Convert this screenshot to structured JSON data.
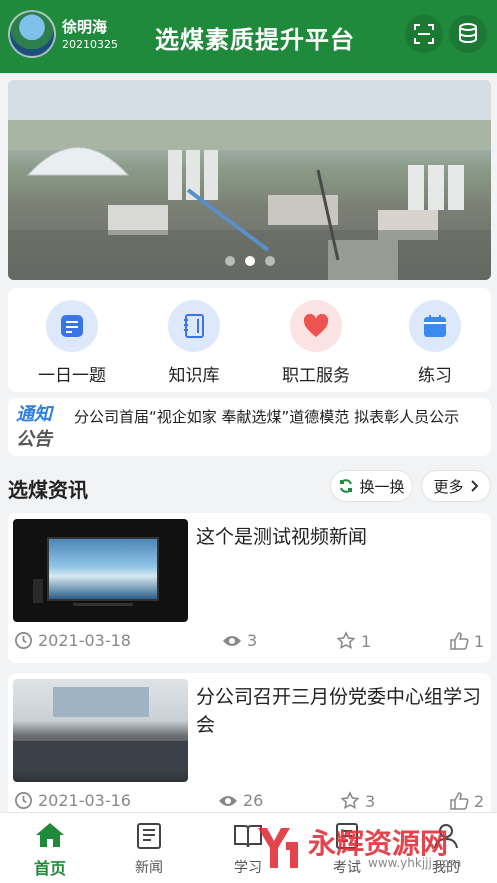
{
  "header": {
    "user_name": "徐明海",
    "user_id": "20210325",
    "title": "选煤素质提升平台",
    "scan_icon": "scan-icon",
    "data_icon": "database-icon",
    "accent": "#1f8a3b"
  },
  "banner": {
    "dot_count": 3,
    "active_dot": 1
  },
  "quick_menu": [
    {
      "label": "一日一题",
      "icon": "note-icon",
      "bg": "#dde9fb",
      "fg": "#3a74e6"
    },
    {
      "label": "知识库",
      "icon": "book-icon",
      "bg": "#dde9fb",
      "fg": "#3a74e6"
    },
    {
      "label": "职工服务",
      "icon": "heart-icon",
      "bg": "#fbe3e3",
      "fg": "#ef5350"
    },
    {
      "label": "练习",
      "icon": "calendar-icon",
      "bg": "#dde9fb",
      "fg": "#3a8bf0"
    }
  ],
  "notice": {
    "logo_line1": "通知",
    "logo_line2": "公告",
    "text": "分公司首届“视企如家 奉献选煤”道德模范 拟表彰人员公示"
  },
  "news_section": {
    "title": "选煤资讯",
    "refresh_label": "换一换",
    "more_label": "更多"
  },
  "news": [
    {
      "title": "这个是测试视频新闻",
      "date": "2021-03-18",
      "views": "3",
      "stars": "1",
      "likes": "1"
    },
    {
      "title": "分公司召开三月份党委中心组学习会",
      "date": "2021-03-16",
      "views": "26",
      "stars": "3",
      "likes": "2"
    }
  ],
  "tabs": [
    {
      "label": "首页",
      "icon": "home-icon",
      "active": true
    },
    {
      "label": "新闻",
      "icon": "newspaper-icon",
      "active": false
    },
    {
      "label": "学习",
      "icon": "open-book-icon",
      "active": false
    },
    {
      "label": "考试",
      "icon": "exam-icon",
      "active": false
    },
    {
      "label": "我的",
      "icon": "user-icon",
      "active": false
    }
  ],
  "watermark": {
    "text": "永辉资源网",
    "url": "www.yhkjjj.com"
  }
}
